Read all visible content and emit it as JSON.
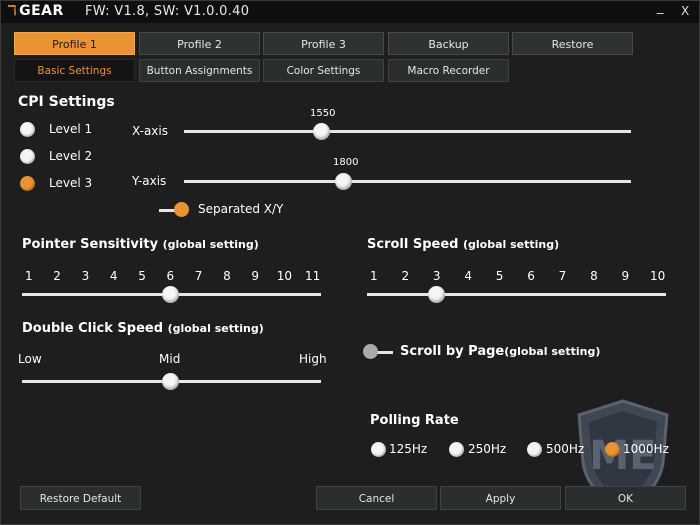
{
  "titlebar": {
    "logo_glyph": "ℸ",
    "logo_text": "GEAR",
    "version": "FW: V1.8, SW: V1.0.0.40",
    "minimize": "_",
    "close": "X"
  },
  "tabs": [
    {
      "label": "Profile 1",
      "active": true
    },
    {
      "label": "Profile 2",
      "active": false
    },
    {
      "label": "Profile 3",
      "active": false
    },
    {
      "label": "Backup",
      "active": false
    },
    {
      "label": "Restore",
      "active": false
    }
  ],
  "subtabs": [
    {
      "label": "Basic Settings",
      "active": true
    },
    {
      "label": "Button Assignments",
      "active": false
    },
    {
      "label": "Color Settings",
      "active": false
    },
    {
      "label": "Macro Recorder",
      "active": false
    }
  ],
  "cpi": {
    "title": "CPI Settings",
    "levels": [
      {
        "label": "Level 1",
        "selected": false
      },
      {
        "label": "Level 2",
        "selected": false
      },
      {
        "label": "Level 3",
        "selected": true
      }
    ],
    "x_label": "X-axis",
    "x_value": "1550",
    "y_label": "Y-axis",
    "y_value": "1800",
    "separated_label": "Separated X/Y",
    "separated_on": true
  },
  "pointer": {
    "title": "Pointer Sensitivity",
    "suffix": "(global setting)",
    "ticks": [
      "1",
      "2",
      "3",
      "4",
      "5",
      "6",
      "7",
      "8",
      "9",
      "10",
      "11"
    ],
    "value": 6
  },
  "scroll_speed": {
    "title": "Scroll Speed",
    "suffix": "(global setting)",
    "ticks": [
      "1",
      "2",
      "3",
      "4",
      "5",
      "6",
      "7",
      "8",
      "9",
      "10"
    ],
    "value": 3
  },
  "double_click": {
    "title": "Double Click Speed",
    "suffix": "(global setting)",
    "low": "Low",
    "mid": "Mid",
    "high": "High"
  },
  "scroll_by_page": {
    "label": "Scroll by Page",
    "suffix": "(global setting)",
    "on": false
  },
  "polling": {
    "title": "Polling Rate",
    "options": [
      {
        "label": "125Hz",
        "selected": false
      },
      {
        "label": "250Hz",
        "selected": false
      },
      {
        "label": "500Hz",
        "selected": false
      },
      {
        "label": "1000Hz",
        "selected": true
      }
    ]
  },
  "buttons": {
    "restore_default": "Restore Default",
    "cancel": "Cancel",
    "apply": "Apply",
    "ok": "OK"
  },
  "colors": {
    "accent": "#e99333",
    "background": "#1e1e1e"
  }
}
